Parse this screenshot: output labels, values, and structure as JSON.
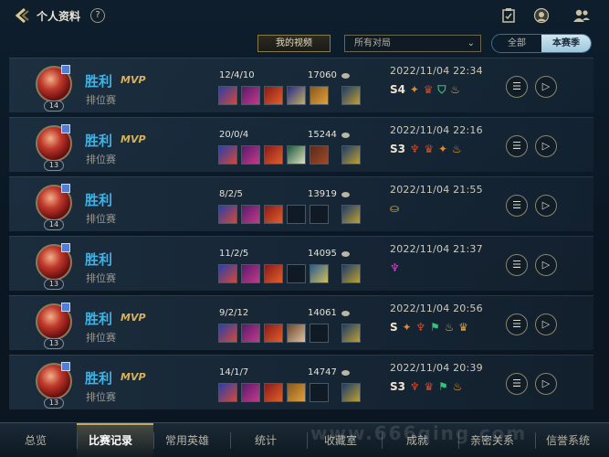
{
  "header": {
    "title": "个人资料",
    "help": "?"
  },
  "filters": {
    "my_video_label": "我的视频",
    "match_type_value": "所有对局",
    "season_tabs": [
      "全部",
      "本赛季"
    ],
    "active_season_tab": 1
  },
  "matches": [
    {
      "result": "胜利",
      "mvp": "MVP",
      "mode": "排位赛",
      "level": "14",
      "kda": "12/4/10",
      "gold": "17060",
      "time": "2022/11/04 22:34",
      "badges": "S4"
    },
    {
      "result": "胜利",
      "mvp": "MVP",
      "mode": "排位赛",
      "level": "13",
      "kda": "20/0/4",
      "gold": "15244",
      "time": "2022/11/04 22:16",
      "badges": "S3"
    },
    {
      "result": "胜利",
      "mvp": "",
      "mode": "排位赛",
      "level": "14",
      "kda": "8/2/5",
      "gold": "13919",
      "time": "2022/11/04 21:55",
      "badges": ""
    },
    {
      "result": "胜利",
      "mvp": "",
      "mode": "排位赛",
      "level": "13",
      "kda": "11/2/5",
      "gold": "14095",
      "time": "2022/11/04 21:37",
      "badges": ""
    },
    {
      "result": "胜利",
      "mvp": "MVP",
      "mode": "排位赛",
      "level": "13",
      "kda": "9/2/12",
      "gold": "14061",
      "time": "2022/11/04 20:56",
      "badges": "S"
    },
    {
      "result": "胜利",
      "mvp": "MVP",
      "mode": "排位赛",
      "level": "13",
      "kda": "14/1/7",
      "gold": "14747",
      "time": "2022/11/04 20:39",
      "badges": "S3"
    }
  ],
  "nav": {
    "tabs": [
      "总览",
      "比赛记录",
      "常用英雄",
      "统计",
      "收藏室",
      "成就",
      "亲密关系",
      "信誉系统"
    ],
    "active_tab": 1
  },
  "watermark": "www.666qing.com",
  "colors": {
    "accent_blue": "#3fb3e6",
    "mvp_gold": "#d8b25a",
    "background": "#0b1723"
  }
}
